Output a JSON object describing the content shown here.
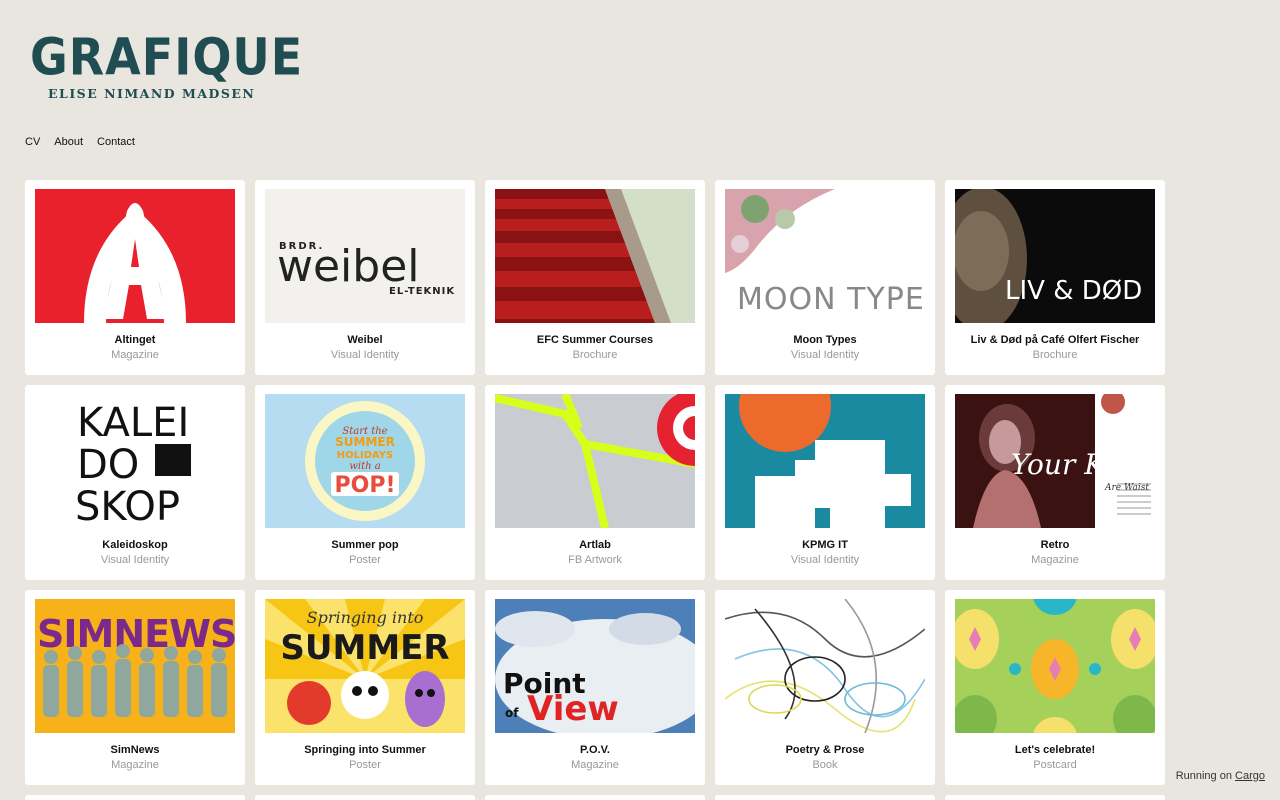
{
  "logo": {
    "title": "GRAFIQUE",
    "subtitle": "ELISE NIMAND MADSEN"
  },
  "nav": [
    "CV",
    "About",
    "Contact"
  ],
  "projects": [
    {
      "title": "Altinget",
      "category": "Magazine"
    },
    {
      "title": "Weibel",
      "category": "Visual Identity"
    },
    {
      "title": "EFC Summer Courses",
      "category": "Brochure"
    },
    {
      "title": "Moon Types",
      "category": "Visual Identity"
    },
    {
      "title": "Liv & Død på Café Olfert Fischer",
      "category": "Brochure"
    },
    {
      "title": "Kaleidoskop",
      "category": "Visual Identity"
    },
    {
      "title": "Summer pop",
      "category": "Poster"
    },
    {
      "title": "Artlab",
      "category": "FB Artwork"
    },
    {
      "title": "KPMG IT",
      "category": "Visual Identity"
    },
    {
      "title": "Retro",
      "category": "Magazine"
    },
    {
      "title": "SimNews",
      "category": "Magazine"
    },
    {
      "title": "Springing into Summer",
      "category": "Poster"
    },
    {
      "title": "P.O.V.",
      "category": "Magazine"
    },
    {
      "title": "Poetry & Prose",
      "category": "Book"
    },
    {
      "title": "Let's celebrate!",
      "category": "Postcard"
    }
  ],
  "thumb_text": {
    "weibel_top": "BRDR.",
    "weibel_main": "weibel",
    "weibel_sub": "EL-TEKNIK",
    "moon": "MOON TYPES",
    "liv": "LIV & DØD",
    "kalei": [
      "KALEI",
      "DO",
      "SKOP"
    ],
    "summerpop": [
      "Start the",
      "SUMMER",
      "HOLIDAYS",
      "with a",
      "POP!"
    ],
    "retro": [
      "Your Kisses",
      "Are Waist"
    ],
    "simnews": [
      "SIM",
      "NEWS"
    ],
    "springing": [
      "Springing into",
      "SUMMER"
    ],
    "pov": [
      "Point",
      "of",
      "View"
    ]
  },
  "footer": {
    "text": "Running on",
    "link": "Cargo"
  }
}
